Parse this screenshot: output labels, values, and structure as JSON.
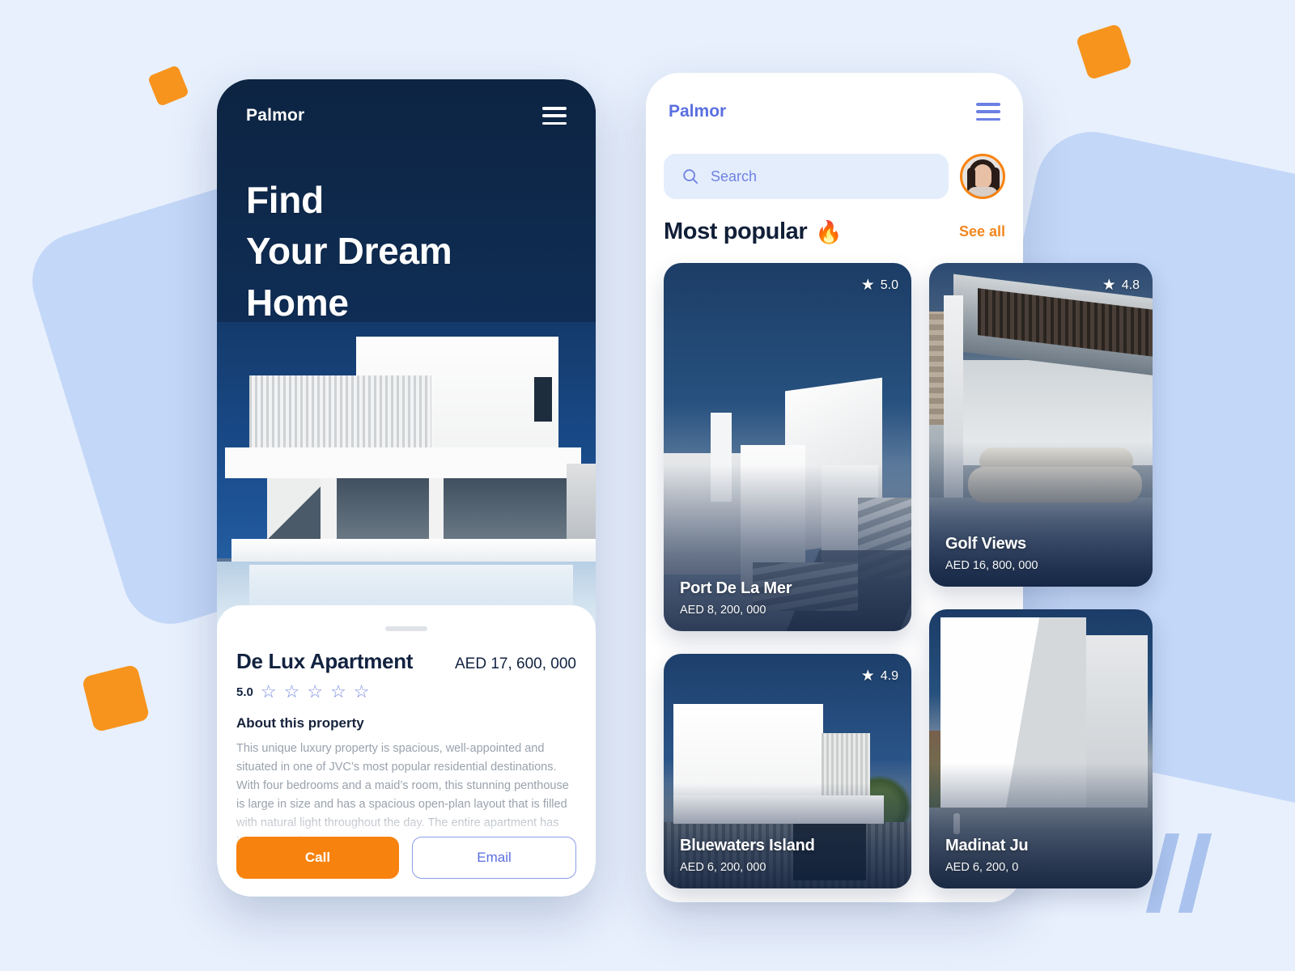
{
  "background": {
    "page_bg": "#e8f0fd",
    "accent_blue_shape": "#c3d7f8",
    "accent_orange": "#f7941e",
    "slash_color": "#aac3ee"
  },
  "left_phone": {
    "brand": "Palmor",
    "menu_icon": "hamburger-icon",
    "headline_line1": "Find",
    "headline_line2": "Your Dream",
    "headline_line3": "Home",
    "hero_image_alt": "modern white villa with reflecting pool",
    "sheet": {
      "property_title": "De Lux Apartment",
      "property_price": "AED 17, 600, 000",
      "rating_value": "5.0",
      "stars": [
        "☆",
        "☆",
        "☆",
        "☆",
        "☆"
      ],
      "about_heading": "About this property",
      "about_text": "This unique luxury property is spacious, well-appointed and situated in one of JVC’s most popular residential destinations. With four bedrooms and a maid’s room, this stunning penthouse is large in size and has a spacious open-plan layout that is filled with natural light throughout the day. The entire apartment has been recently",
      "call_label": "Call",
      "email_label": "Email",
      "call_color": "#f7820e",
      "email_color": "#5a6fe0"
    }
  },
  "right_phone": {
    "brand": "Palmor",
    "brand_color": "#5a6fe0",
    "menu_icon": "hamburger-icon",
    "search": {
      "icon": "search-icon",
      "placeholder": "Search",
      "value": ""
    },
    "avatar_alt": "user profile photo",
    "section": {
      "title": "Most popular",
      "emoji": "🔥",
      "see_all_label": "See all",
      "see_all_color": "#f2871f"
    },
    "cards": [
      {
        "name": "Port De La Mer",
        "price": "AED 8, 200, 000",
        "rating": "5.0",
        "star_icon": "star-filled-icon",
        "image_alt": "white cubic mediterranean architecture with stairs"
      },
      {
        "name": "Golf Views",
        "price": "AED 16, 800, 000",
        "rating": "4.8",
        "star_icon": "star-filled-icon",
        "image_alt": "outdoor lounge with cushions under pergola"
      },
      {
        "name": "Bluewaters Island",
        "price": "AED 6, 200, 000",
        "rating": "4.9",
        "star_icon": "star-filled-icon",
        "image_alt": "white modern villa with concrete base and trees"
      },
      {
        "name": "Madinat Ju",
        "price": "AED 6, 200, 0",
        "rating": "",
        "star_icon": "",
        "image_alt": "white minimal tower building"
      }
    ]
  }
}
